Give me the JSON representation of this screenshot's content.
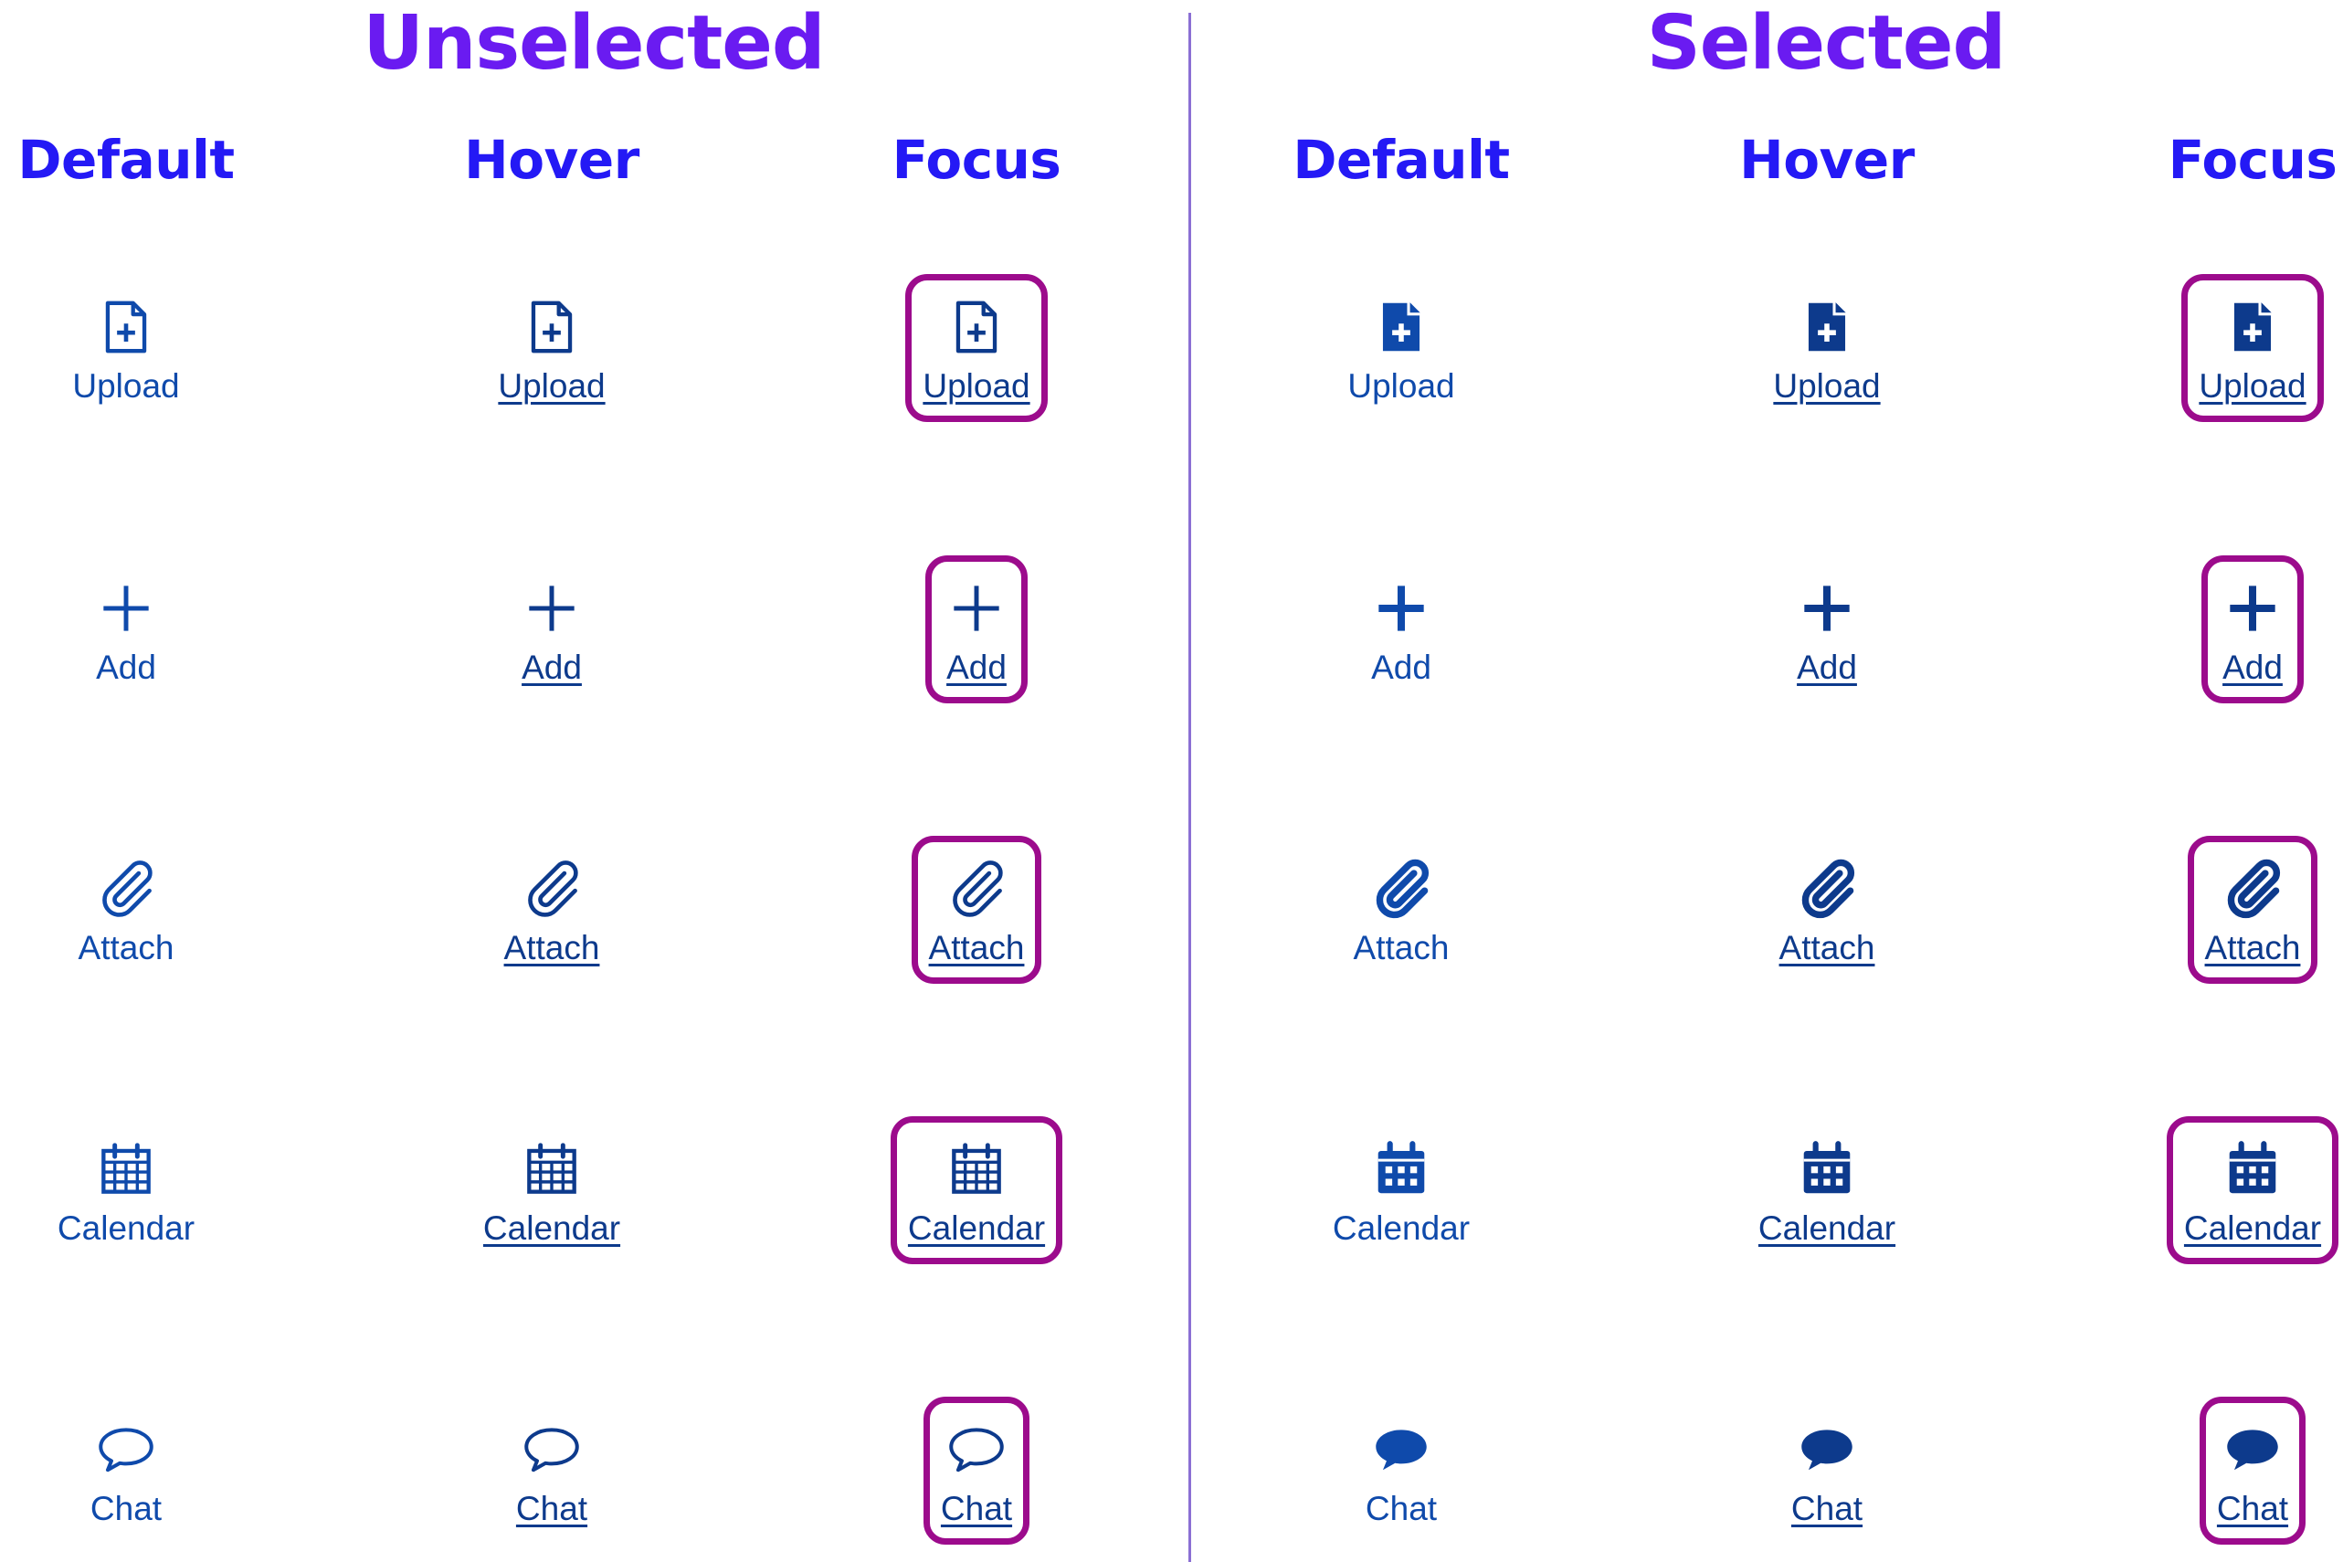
{
  "sections": {
    "unselected": {
      "title": "Unselected"
    },
    "selected": {
      "title": "Selected"
    }
  },
  "columns": [
    "Default",
    "Hover",
    "Focus"
  ],
  "items": [
    {
      "label": "Upload",
      "icon": "file-plus-icon"
    },
    {
      "label": "Add",
      "icon": "plus-icon"
    },
    {
      "label": "Attach",
      "icon": "paperclip-icon"
    },
    {
      "label": "Calendar",
      "icon": "calendar-icon"
    },
    {
      "label": "Chat",
      "icon": "chat-bubble-icon"
    }
  ],
  "colors": {
    "section_title": "#6a1bf1",
    "column_header": "#2419f5",
    "icon_default": "#0f4aab",
    "icon_hover": "#0d3a8c",
    "focus_ring": "#9c0b8c",
    "divider": "#8b6fd4"
  }
}
